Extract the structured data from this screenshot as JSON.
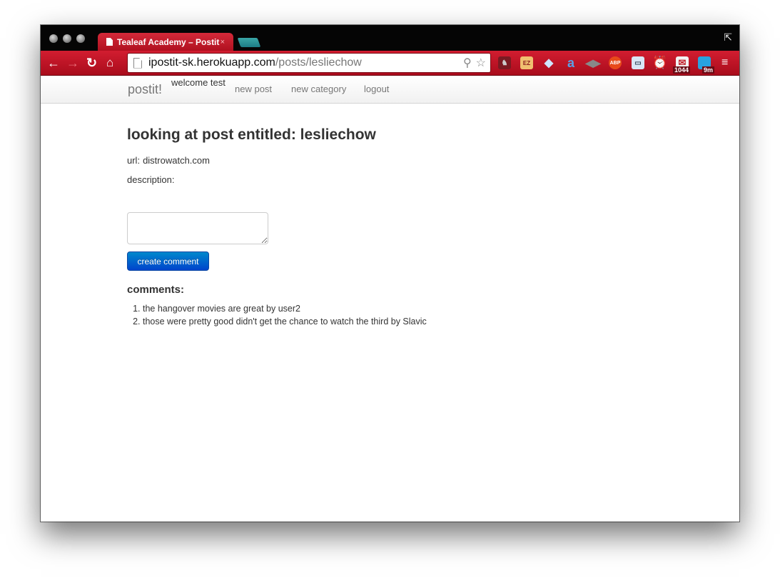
{
  "browser": {
    "tab_title": "Tealeaf Academy – Postit",
    "tab_close": "×",
    "url_host": "ipostit-sk.herokuapp.com",
    "url_path": "/posts/lesliechow",
    "extensions": {
      "ez_label": "EZ",
      "abp_label": "ABP",
      "gmail_count": "1044",
      "timer_label": "9m"
    },
    "colors": {
      "frame": "#c41a2b",
      "accent": "#0044cc"
    }
  },
  "site": {
    "brand": "postit!",
    "welcome": "welcome test",
    "nav": [
      "new post",
      "new category",
      "logout"
    ]
  },
  "post": {
    "heading": "looking at post entitled: lesliechow",
    "url_label": "url:",
    "url_value": "distrowatch.com",
    "description_label": "description:",
    "description_value": ""
  },
  "comment_form": {
    "textarea_value": "",
    "submit_label": "create comment"
  },
  "comments": {
    "heading": "comments:",
    "items": [
      "the hangover movies are great by user2",
      "those were pretty good didn't get the chance to watch the third by Slavic"
    ]
  }
}
